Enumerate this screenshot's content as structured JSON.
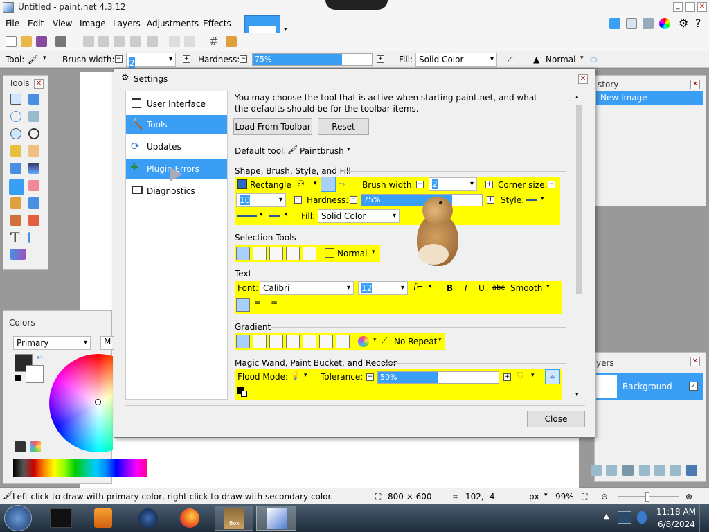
{
  "app": {
    "title": "Untitled - paint.net 4.3.12"
  },
  "menu": [
    "File",
    "Edit",
    "View",
    "Image",
    "Layers",
    "Adjustments",
    "Effects"
  ],
  "toolbar": {
    "tool_label": "Tool:",
    "brush_width_label": "Brush width:",
    "brush_width_value": "2",
    "hardness_label": "Hardness:",
    "hardness_value": "75%",
    "hardness_fraction": 0.75,
    "fill_label": "Fill:",
    "fill_value": "Solid Color",
    "blend_value": "Normal"
  },
  "tools_panel": {
    "title": "Tools"
  },
  "history_panel": {
    "title": "story",
    "item": "New Image"
  },
  "layers_panel": {
    "title": "yers",
    "item": "Background"
  },
  "colors_panel": {
    "title": "Colors",
    "mode": "Primary",
    "more": "M"
  },
  "settings": {
    "title": "Settings",
    "nav": [
      {
        "label": "User Interface",
        "icon": "window-icon"
      },
      {
        "label": "Tools",
        "icon": "hammer-icon"
      },
      {
        "label": "Updates",
        "icon": "refresh-icon"
      },
      {
        "label": "Plugin Errors",
        "icon": "puzzle-warning-icon"
      },
      {
        "label": "Diagnostics",
        "icon": "monitor-icon"
      }
    ],
    "selected_nav": "Tools",
    "description": "You may choose the tool that is active when starting paint.net, and what the defaults should be for the toolbar items.",
    "load_button": "Load From Toolbar",
    "reset_button": "Reset",
    "default_tool_label": "Default tool:",
    "default_tool_value": "Paintbrush",
    "section_shape": "Shape, Brush, Style, and Fill",
    "shape_value": "Rectangle",
    "brush_width_label": "Brush width:",
    "brush_width_value": "2",
    "corner_size_label": "Corner size:",
    "corner_size_value": "10",
    "hardness_label": "Hardness:",
    "hardness_value": "75%",
    "hardness_fraction": 0.75,
    "style_label": "Style:",
    "fill_label": "Fill:",
    "fill_value": "Solid Color",
    "section_selection": "Selection Tools",
    "selection_mode": "Normal",
    "section_text": "Text",
    "font_label": "Font:",
    "font_value": "Calibri",
    "font_size": "12",
    "bold": "B",
    "italic": "I",
    "underline": "U",
    "strike": "abc",
    "antialias": "Smooth",
    "section_gradient": "Gradient",
    "repeat_value": "No Repeat",
    "section_wand": "Magic Wand, Paint Bucket, and Recolor",
    "flood_mode_label": "Flood Mode:",
    "tolerance_label": "Tolerance:",
    "tolerance_value": "50%",
    "tolerance_fraction": 0.5,
    "close_button": "Close"
  },
  "status": {
    "hint": "Left click to draw with primary color, right click to draw with secondary color.",
    "size": "800 × 600",
    "coords": "102, -4",
    "unit": "px",
    "zoom": "99%"
  },
  "taskbar": {
    "time": "11:18 AM",
    "date": "6/8/2024",
    "box_label": "Box"
  },
  "colors": {
    "accent": "#3b9ef5",
    "highlight": "#ffff00"
  }
}
